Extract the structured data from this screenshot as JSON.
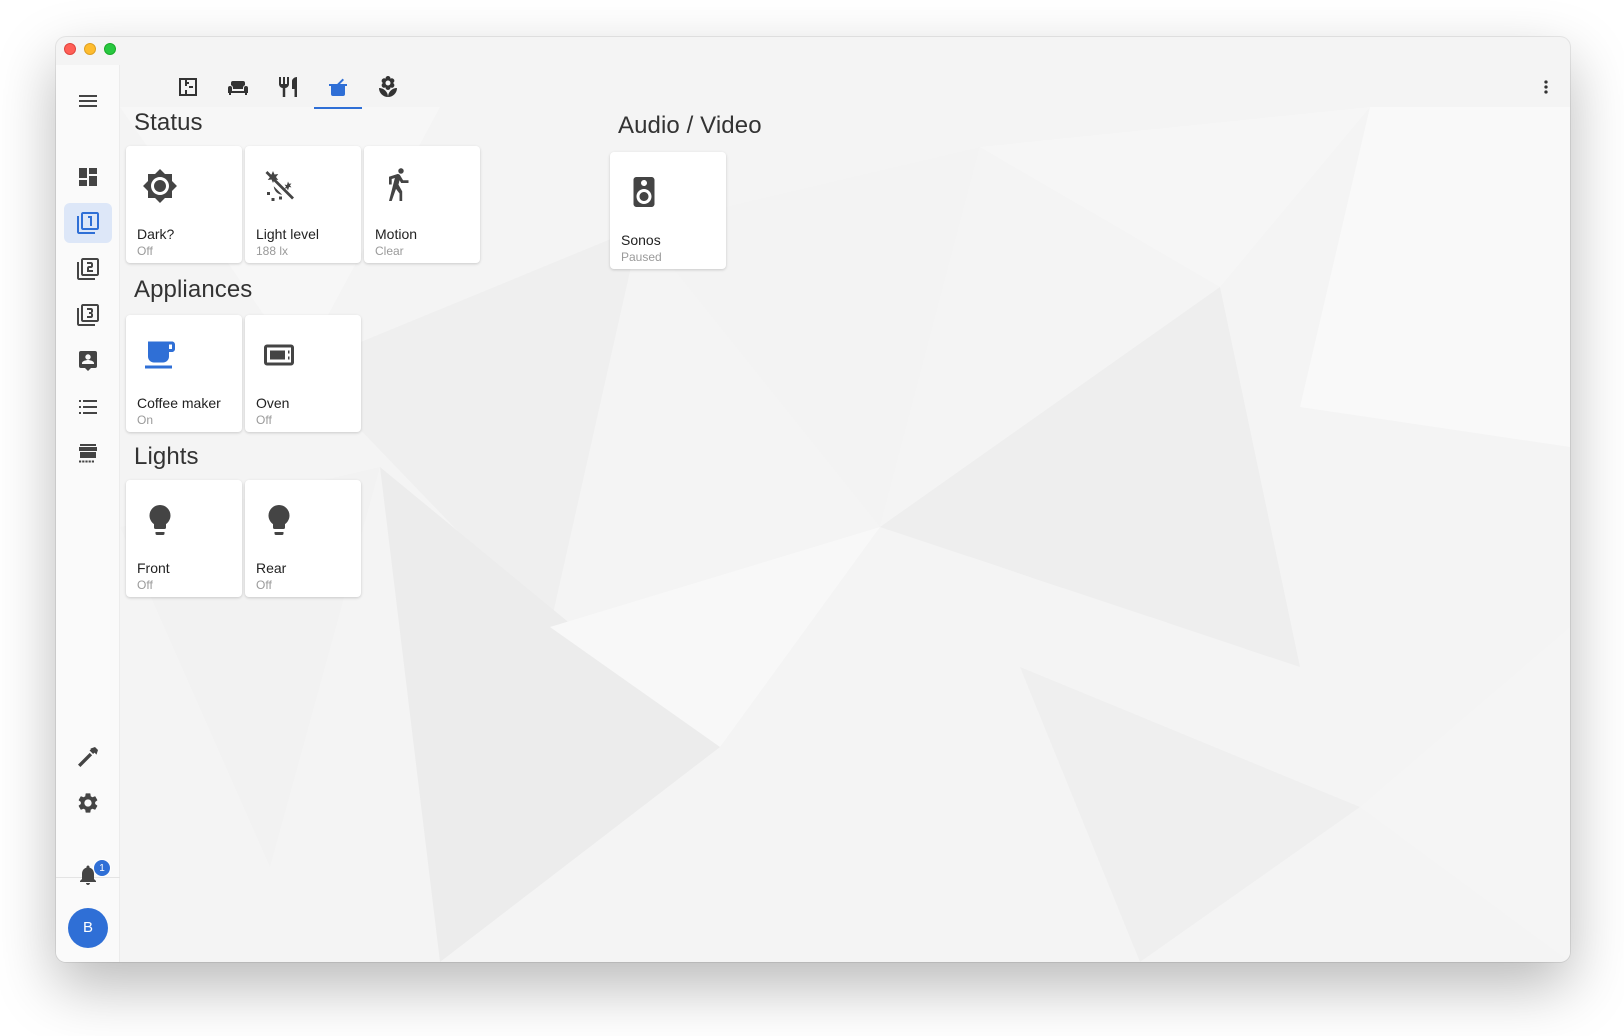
{
  "sidebar": {
    "items": [
      {
        "icon": "dashboard-icon"
      },
      {
        "icon": "filter-1-icon",
        "active": true
      },
      {
        "icon": "filter-2-icon"
      },
      {
        "icon": "filter-3-icon"
      },
      {
        "icon": "account-box-icon"
      },
      {
        "icon": "format-list-icon"
      },
      {
        "icon": "hacs-store-icon"
      }
    ],
    "bottom": [
      {
        "icon": "hammer-icon"
      },
      {
        "icon": "gear-icon"
      }
    ],
    "notification_count": "1",
    "user_initial": "B"
  },
  "topbar": {
    "tabs": [
      {
        "icon": "floor-plan-icon"
      },
      {
        "icon": "sofa-icon"
      },
      {
        "icon": "silverware-icon"
      },
      {
        "icon": "pot-icon",
        "active": true
      },
      {
        "icon": "flower-icon"
      }
    ],
    "menu_icon": "dots-vertical-icon",
    "accent_color": "#2f6fd6"
  },
  "sections": {
    "status": {
      "title": "Status",
      "cards": [
        {
          "name": "Dark?",
          "state": "Off",
          "icon": "brightness-icon"
        },
        {
          "name": "Light level",
          "state": "188 lx",
          "icon": "weather-night-partly-icon"
        },
        {
          "name": "Motion",
          "state": "Clear",
          "icon": "walk-icon"
        }
      ]
    },
    "appliances": {
      "title": "Appliances",
      "cards": [
        {
          "name": "Coffee maker",
          "state": "On",
          "icon": "coffee-icon"
        },
        {
          "name": "Oven",
          "state": "Off",
          "icon": "oven-icon"
        }
      ]
    },
    "lights": {
      "title": "Lights",
      "cards": [
        {
          "name": "Front",
          "state": "Off",
          "icon": "lightbulb-icon"
        },
        {
          "name": "Rear",
          "state": "Off",
          "icon": "lightbulb-icon"
        }
      ]
    },
    "audio_video": {
      "title": "Audio / Video",
      "cards": [
        {
          "name": "Sonos",
          "state": "Paused",
          "icon": "speaker-icon"
        }
      ]
    }
  }
}
